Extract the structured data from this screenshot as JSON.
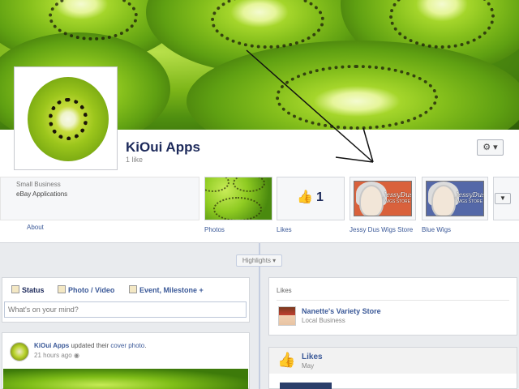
{
  "page": {
    "name": "KiOui Apps",
    "likes_text": "1 like",
    "settings_icon": "gear-icon"
  },
  "about": {
    "category": "Small Business",
    "description": "eBay Applications",
    "link": "About"
  },
  "tiles": [
    {
      "label": "Photos"
    },
    {
      "label": "Likes",
      "count": "1"
    },
    {
      "label": "Jessy Dus Wigs Store",
      "art_text": "JessyDus",
      "art_sub": "WIGS STORE"
    },
    {
      "label": "Blue Wigs",
      "art_text": "JessyDus",
      "art_sub": "WIGS STORE"
    }
  ],
  "timeline": {
    "highlights_label": "Highlights ▾"
  },
  "composer": {
    "tabs": [
      "Status",
      "Photo / Video",
      "Event, Milestone +"
    ],
    "placeholder": "What's on your mind?"
  },
  "post": {
    "author": "KiOui Apps",
    "action": " updated their ",
    "object": "cover photo",
    "suffix": ".",
    "time": "21 hours ago"
  },
  "likes_box": {
    "title": "Likes",
    "item_name": "Nanette's Variety Store",
    "item_category": "Local Business"
  },
  "likes_box2": {
    "title": "Likes",
    "subtitle": "May"
  },
  "colors": {
    "link": "#3b5998",
    "brand": "#4267b2"
  }
}
